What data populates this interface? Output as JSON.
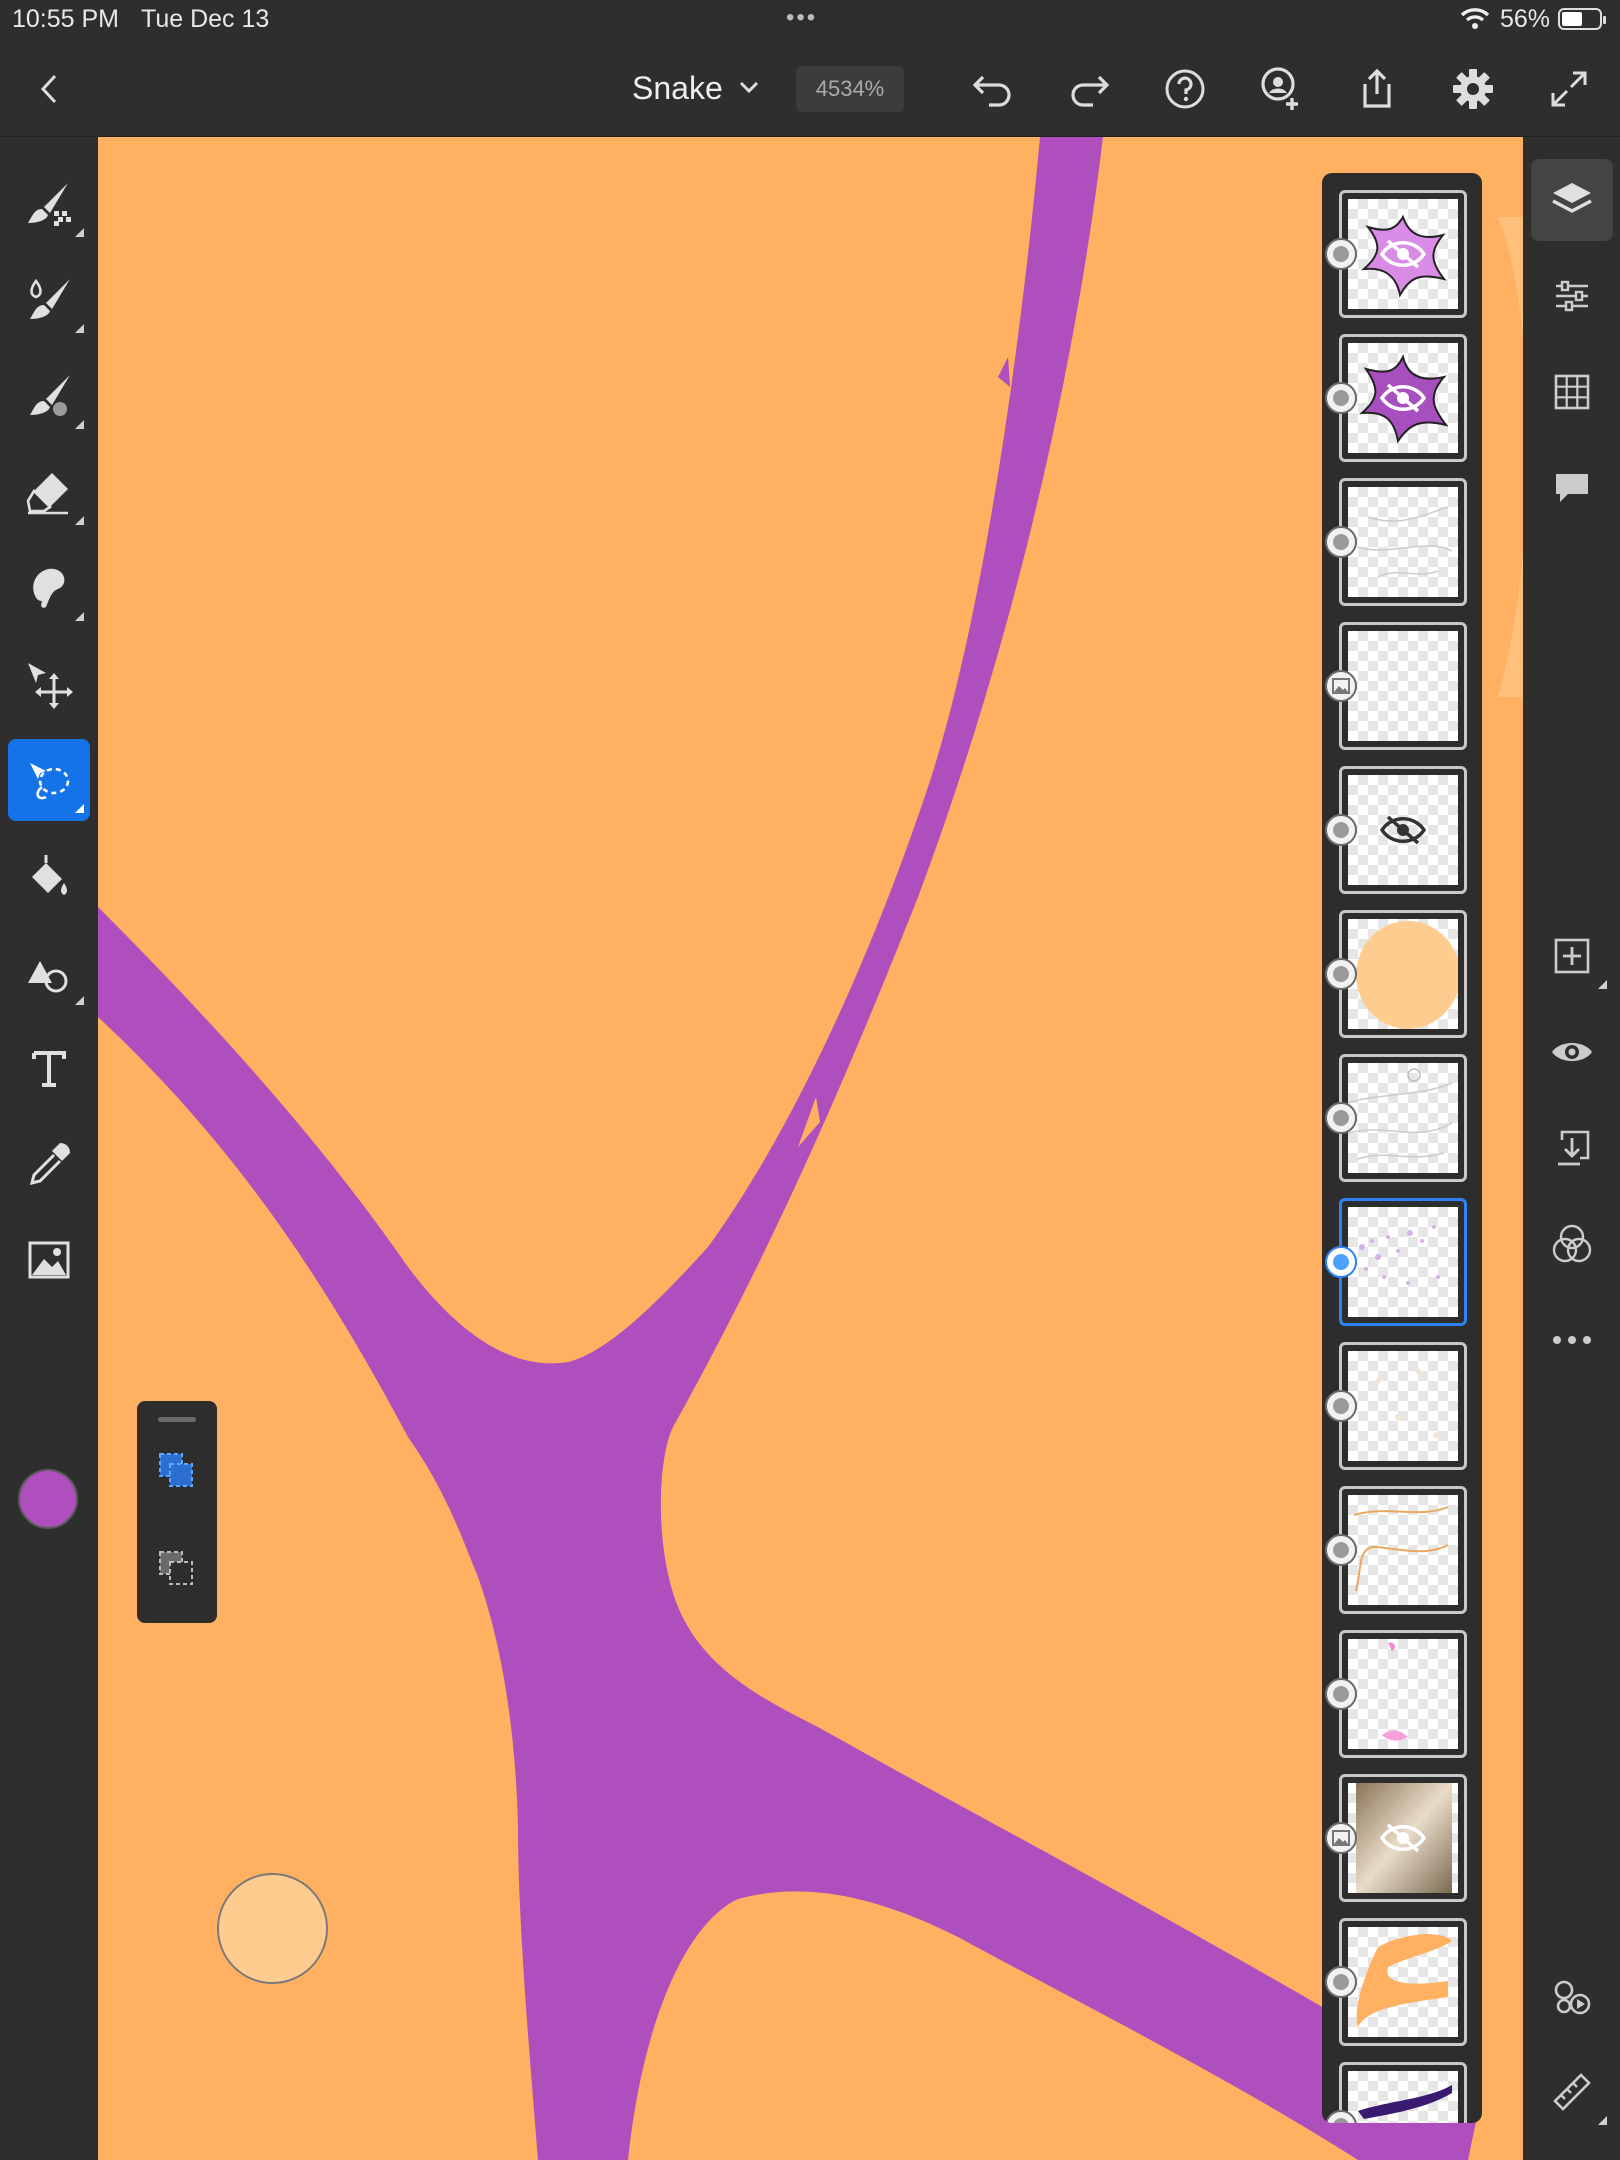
{
  "status_bar": {
    "time": "10:55 PM",
    "date": "Tue Dec 13",
    "multitask": "•••",
    "battery_percent": "56%",
    "battery_level": 0.56
  },
  "header": {
    "document_title": "Snake",
    "zoom_level": "4534%"
  },
  "toolbar_left": {
    "tools": [
      "pixel-brush",
      "live-brush",
      "vector-brush",
      "eraser",
      "smudge",
      "move-transform",
      "selection",
      "fill",
      "shapes",
      "text",
      "eyedropper",
      "place-image"
    ],
    "active_tool": "selection",
    "current_color": "#ae4fbd"
  },
  "selection_popover": {
    "options": [
      "add-to-selection",
      "subtract-from-selection"
    ],
    "active": "add-to-selection"
  },
  "canvas": {
    "background": "#ffb060",
    "stroke_color": "#ae4fbd"
  },
  "brush_preview_color": "#ffcc90",
  "layers": [
    {
      "type": "pixel",
      "hidden": true,
      "selected": false
    },
    {
      "type": "pixel",
      "hidden": true,
      "selected": false
    },
    {
      "type": "pixel",
      "hidden": false,
      "selected": false
    },
    {
      "type": "image",
      "hidden": false,
      "selected": false
    },
    {
      "type": "pixel",
      "hidden": true,
      "selected": false
    },
    {
      "type": "pixel",
      "hidden": false,
      "selected": false
    },
    {
      "type": "pixel",
      "hidden": false,
      "selected": false
    },
    {
      "type": "pixel",
      "hidden": false,
      "selected": true
    },
    {
      "type": "pixel",
      "hidden": false,
      "selected": false
    },
    {
      "type": "pixel",
      "hidden": false,
      "selected": false
    },
    {
      "type": "pixel",
      "hidden": false,
      "selected": false
    },
    {
      "type": "image",
      "hidden": true,
      "selected": false
    },
    {
      "type": "pixel",
      "hidden": false,
      "selected": false
    },
    {
      "type": "pixel",
      "hidden": false,
      "selected": false
    }
  ],
  "toolbar_right": {
    "top": [
      "layers",
      "layer-properties",
      "grid",
      "comments"
    ],
    "middle": [
      "add-layer",
      "visibility",
      "merge-down",
      "blend-modes",
      "more"
    ],
    "bottom": [
      "livestream",
      "ruler"
    ],
    "active": "layers"
  }
}
